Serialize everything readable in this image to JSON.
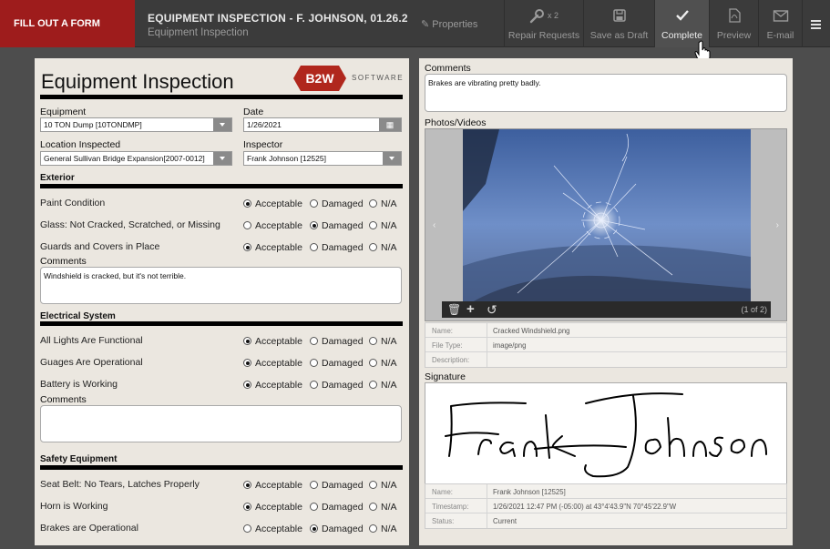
{
  "header": {
    "brand": "FILL OUT A FORM",
    "doc_title": "EQUIPMENT INSPECTION - F. JOHNSON, 01.26.21, ...",
    "doc_subtitle": "Equipment Inspection",
    "properties_label": "Properties",
    "repair_count": "x 2",
    "repair_label": "Repair Requests",
    "save_draft_label": "Save as Draft",
    "complete_label": "Complete",
    "preview_label": "Preview",
    "email_label": "E-mail"
  },
  "form": {
    "title": "Equipment Inspection",
    "logo_text": "B2W",
    "logo_subtext": "SOFTWARE",
    "equipment_label": "Equipment",
    "equipment_value": "10 TON Dump [10TONDMP]",
    "date_label": "Date",
    "date_value": "1/26/2021",
    "location_label": "Location Inspected",
    "location_value": "General Sullivan Bridge Expansion[2007-0012]",
    "inspector_label": "Inspector",
    "inspector_value": "Frank Johnson [12525]",
    "option_labels": [
      "Acceptable",
      "Damaged",
      "N/A"
    ],
    "sections": [
      {
        "title": "Exterior",
        "questions": [
          {
            "label": "Paint Condition",
            "selected": "Acceptable"
          },
          {
            "label": "Glass: Not Cracked, Scratched, or Missing",
            "selected": "Damaged"
          },
          {
            "label": "Guards and Covers in Place",
            "selected": "Acceptable"
          }
        ],
        "comments_label": "Comments",
        "comments": "Windshield is cracked, but it's not terrible."
      },
      {
        "title": "Electrical System",
        "questions": [
          {
            "label": "All Lights Are Functional",
            "selected": "Acceptable"
          },
          {
            "label": "Guages Are Operational",
            "selected": "Acceptable"
          },
          {
            "label": "Battery is Working",
            "selected": "Acceptable"
          }
        ],
        "comments_label": "Comments",
        "comments": ""
      },
      {
        "title": "Safety Equipment",
        "questions": [
          {
            "label": "Seat Belt: No Tears, Latches Properly",
            "selected": "Acceptable"
          },
          {
            "label": "Horn is Working",
            "selected": "Acceptable"
          },
          {
            "label": "Brakes are Operational",
            "selected": "Damaged"
          }
        ]
      }
    ]
  },
  "right": {
    "comments_label": "Comments",
    "comments": "Brakes are vibrating pretty badly.",
    "photos_label": "Photos/Videos",
    "photo_counter": "(1 of 2)",
    "photo_meta": [
      {
        "key": "Name:",
        "value": "Cracked Windshield.png"
      },
      {
        "key": "File Type:",
        "value": "image/png"
      },
      {
        "key": "Description:",
        "value": ""
      }
    ],
    "signature_label": "Signature",
    "signature_text": "Frank Johnson",
    "signature_meta": [
      {
        "key": "Name:",
        "value": "Frank Johnson [12525]"
      },
      {
        "key": "Timestamp:",
        "value": "1/26/2021 12:47 PM (-05:00) at 43°4'43.9\"N 70°45'22.9\"W"
      },
      {
        "key": "Status:",
        "value": "Current"
      }
    ]
  }
}
